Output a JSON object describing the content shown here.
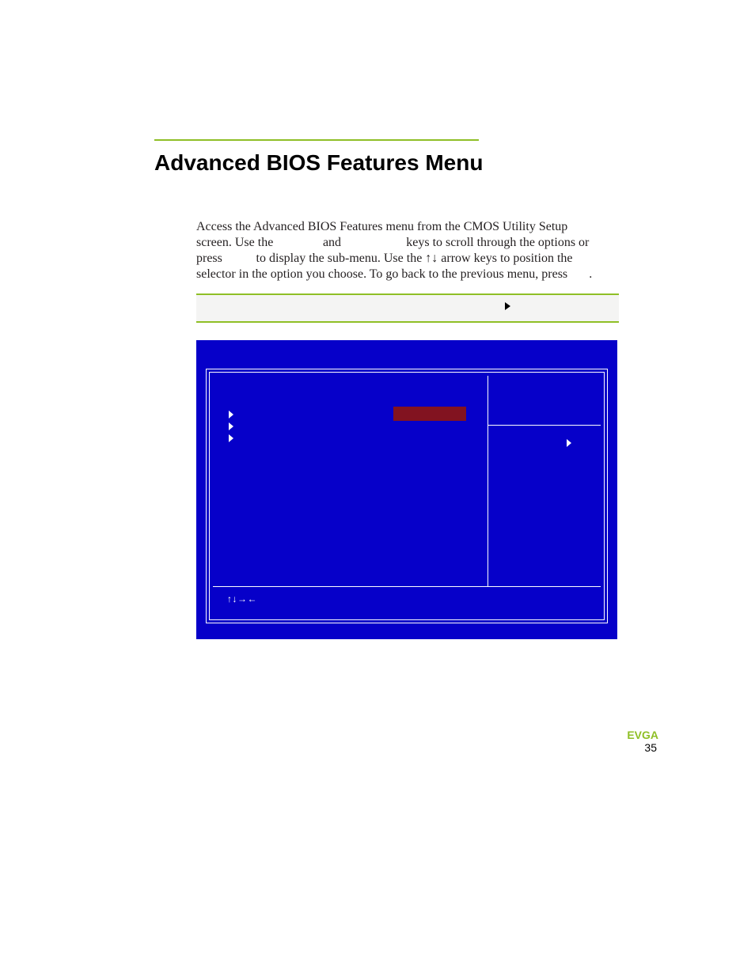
{
  "heading": "Advanced BIOS Features Menu",
  "paragraph": {
    "s1": "Access the Advanced BIOS Features menu from the CMOS Utility Setup",
    "s2a": "screen. Use the ",
    "s2b": " and ",
    "s2c": " keys to scroll through the options or",
    "s3a": "press ",
    "s3b": " to display the sub-menu. Use the ",
    "arrows": "↑↓",
    "s3c": " arrow keys to position the",
    "s4": "selector in the option you choose. To go back to the previous menu, press ",
    "s4end": "."
  },
  "bios": {
    "nav_glyphs": "↑↓→←"
  },
  "footer": {
    "brand": "EVGA",
    "page_number": "35"
  }
}
